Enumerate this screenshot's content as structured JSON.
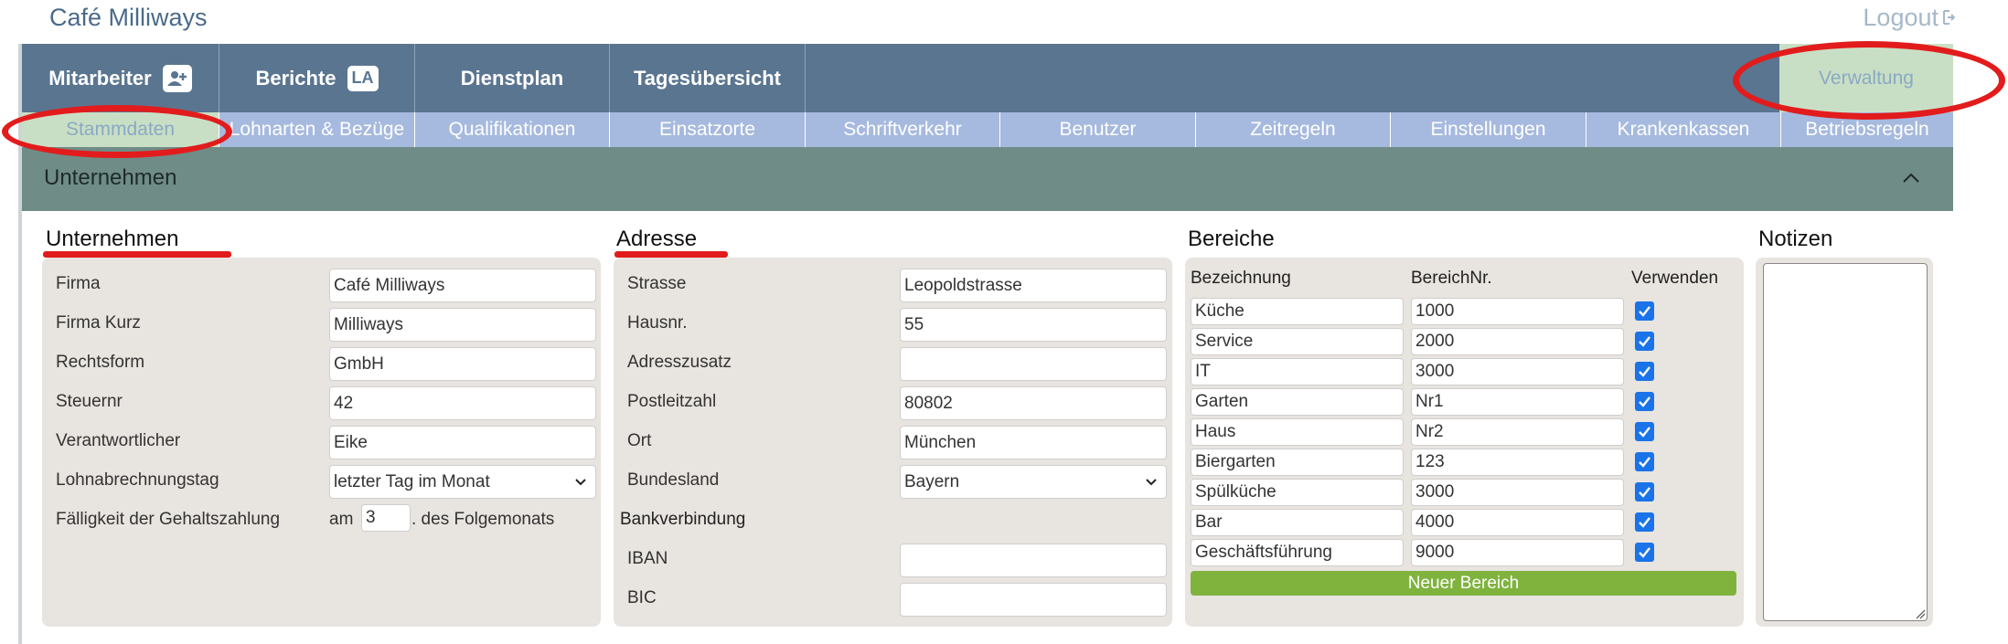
{
  "app": {
    "title": "Café Milliways",
    "logout_label": "Logout"
  },
  "main_nav": {
    "tabs": [
      {
        "label": "Mitarbeiter",
        "badge": ""
      },
      {
        "label": "Berichte",
        "badge": "LA"
      },
      {
        "label": "Dienstplan",
        "badge": ""
      },
      {
        "label": "Tagesübersicht",
        "badge": ""
      }
    ],
    "active_right_label": "Verwaltung"
  },
  "sub_nav": {
    "tabs": [
      "Stammdaten",
      "Lohnarten & Bezüge",
      "Qualifikationen",
      "Einsatzorte",
      "Schriftverkehr",
      "Benutzer",
      "Zeitregeln",
      "Einstellungen",
      "Krankenkassen",
      "Betriebsregeln"
    ],
    "active": "Stammdaten"
  },
  "section": {
    "title": "Unternehmen"
  },
  "unternehmen": {
    "title": "Unternehmen",
    "rows": [
      {
        "label": "Firma",
        "value": "Café Milliways"
      },
      {
        "label": "Firma Kurz",
        "value": "Milliways"
      },
      {
        "label": "Rechtsform",
        "value": "GmbH"
      },
      {
        "label": "Steuernr",
        "value": "42"
      },
      {
        "label": "Verantwortlicher",
        "value": "Eike"
      }
    ],
    "lohn_label": "Lohnabrechnungstag",
    "lohn_value": "letzter Tag im Monat",
    "faellig_label": "Fälligkeit der Gehaltszahlung",
    "faellig_prefix": "am",
    "faellig_value": "3",
    "faellig_suffix": ". des Folgemonats"
  },
  "adresse": {
    "title": "Adresse",
    "rows": [
      {
        "label": "Strasse",
        "value": "Leopoldstrasse"
      },
      {
        "label": "Hausnr.",
        "value": "55"
      },
      {
        "label": "Adresszusatz",
        "value": ""
      },
      {
        "label": "Postleitzahl",
        "value": "80802"
      },
      {
        "label": "Ort",
        "value": "München"
      }
    ],
    "bundesland_label": "Bundesland",
    "bundesland_value": "Bayern",
    "bank_title": "Bankverbindung",
    "iban_label": "IBAN",
    "iban_value": "",
    "bic_label": "BIC",
    "bic_value": ""
  },
  "bereiche": {
    "title": "Bereiche",
    "headers": [
      "Bezeichnung",
      "BereichNr.",
      "Verwenden"
    ],
    "rows": [
      {
        "name": "Küche",
        "nr": "1000",
        "checked": true
      },
      {
        "name": "Service",
        "nr": "2000",
        "checked": true
      },
      {
        "name": "IT",
        "nr": "3000",
        "checked": true
      },
      {
        "name": "Garten",
        "nr": "Nr1",
        "checked": true
      },
      {
        "name": "Haus",
        "nr": "Nr2",
        "checked": true
      },
      {
        "name": "Biergarten",
        "nr": "123",
        "checked": true
      },
      {
        "name": "Spülküche",
        "nr": "3000",
        "checked": true
      },
      {
        "name": "Bar",
        "nr": "4000",
        "checked": true
      },
      {
        "name": "Geschäftsführung",
        "nr": "9000",
        "checked": true
      }
    ],
    "new_button": "Neuer Bereich"
  },
  "notizen": {
    "title": "Notizen",
    "value": ""
  },
  "colors": {
    "nav_bg": "#5a7590",
    "subnav_bg": "#a6b9de",
    "active_tab": "#c9dfc5",
    "section_bg": "#6f8c86",
    "panel_bg": "#e8e4df",
    "button_green": "#7fb33e",
    "checkbox_blue": "#1a73e8",
    "annotation_red": "#e21c1c"
  },
  "icons": {
    "add_user": "person-plus-icon",
    "logout": "logout-icon",
    "collapse": "chevron-up-icon",
    "select": "chevron-down-icon",
    "check": "check-icon"
  }
}
